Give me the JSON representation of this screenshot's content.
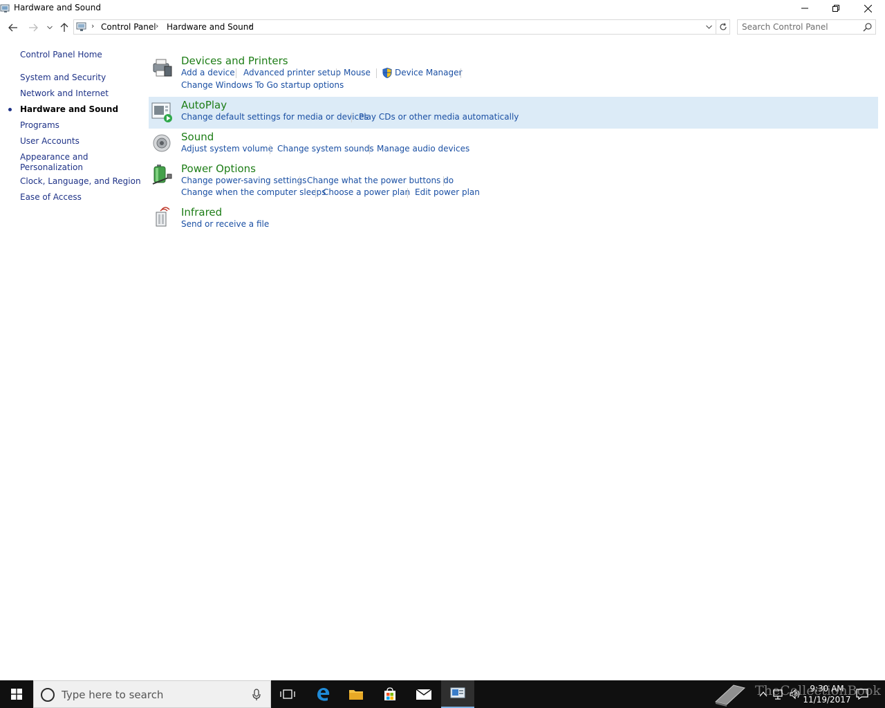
{
  "window": {
    "title": "Hardware and Sound"
  },
  "address": {
    "crumbs": [
      "Control Panel",
      "Hardware and Sound"
    ],
    "search_placeholder": "Search Control Panel"
  },
  "leftnav": {
    "items": [
      {
        "label": "Control Panel Home"
      },
      {
        "label": "System and Security"
      },
      {
        "label": "Network and Internet"
      },
      {
        "label": "Hardware and Sound",
        "current": true
      },
      {
        "label": "Programs"
      },
      {
        "label": "User Accounts"
      },
      {
        "label": "Appearance and"
      },
      {
        "label": "Personalization"
      },
      {
        "label": "Clock, Language, and Region"
      },
      {
        "label": "Ease of Access"
      }
    ]
  },
  "categories": [
    {
      "title": "Devices and Printers",
      "icon": "printer-icon",
      "links": [
        "Add a device",
        "Advanced printer setup",
        "Mouse",
        "Device Manager",
        "Change Windows To Go startup options"
      ]
    },
    {
      "title": "AutoPlay",
      "icon": "autoplay-icon",
      "links": [
        "Change default settings for media or devices",
        "Play CDs or other media automatically"
      ]
    },
    {
      "title": "Sound",
      "icon": "speaker-icon",
      "links": [
        "Adjust system volume",
        "Change system sounds",
        "Manage audio devices"
      ]
    },
    {
      "title": "Power Options",
      "icon": "battery-icon",
      "links": [
        "Change power-saving settings",
        "Change what the power buttons do",
        "Change when the computer sleeps",
        "Choose a power plan",
        "Edit power plan"
      ]
    },
    {
      "title": "Infrared",
      "icon": "infrared-icon",
      "links": [
        "Send or receive a file"
      ]
    }
  ],
  "taskbar": {
    "search_placeholder": "Type here to search",
    "time": "9:30 AM",
    "date": "11/19/2017",
    "watermark": "TheCollectionBook"
  },
  "colors": {
    "category_title": "#1d7d16",
    "link": "#1a4fa3",
    "nav_link": "#1e3287",
    "highlight": "#dcebf7",
    "taskbar": "#101010"
  }
}
